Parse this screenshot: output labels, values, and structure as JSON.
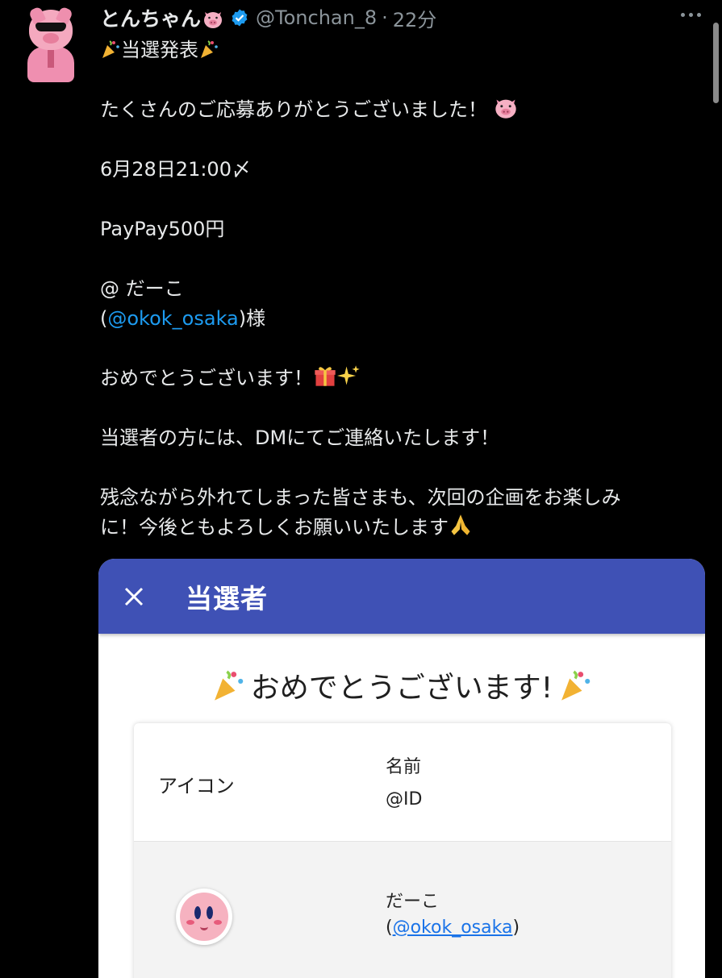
{
  "tweet": {
    "display_name": "とんちゃん",
    "handle": "@Tonchan_8",
    "separator": "·",
    "time": "22分",
    "lines": {
      "title": "当選発表",
      "thanks": "たくさんのご応募ありがとうございました！",
      "deadline": "6月28日21:00〆",
      "prize": "PayPay500円",
      "winner_name": "@ だーこ",
      "winner_open": "(",
      "winner_handle": "@okok_osaka",
      "winner_close": ")様",
      "congrats": "おめでとうございます！",
      "dm_notice": "当選者の方には、DMにてご連絡いたします！",
      "closing_1": "残念ながら外れてしまった皆さまも、次回の企画をお楽しみ",
      "closing_2": "に！今後ともよろしくお願いいたします"
    },
    "emojis": [
      "party-popper",
      "pig-face",
      "gift",
      "sparkles",
      "folded-hands"
    ]
  },
  "card": {
    "appbar_title": "当選者",
    "congrats": "おめでとうございます!",
    "table": {
      "col_icon": "アイコン",
      "col_name": "名前",
      "col_id": "@ID",
      "rows": [
        {
          "name": "だーこ",
          "id_open": "(",
          "id": "@okok_osaka",
          "id_close": ")"
        }
      ]
    }
  },
  "colors": {
    "background": "#000000",
    "text": "#e7e9ea",
    "muted": "#8b949a",
    "link": "#1d9bf0",
    "appbar": "#3f51b5",
    "verified": "#1d9bf0"
  }
}
